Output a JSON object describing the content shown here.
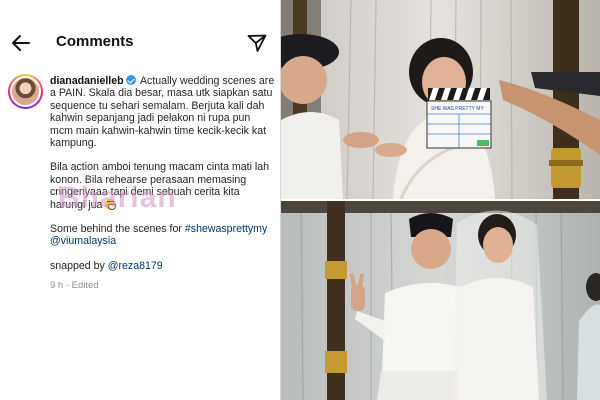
{
  "header": {
    "title": "Comments"
  },
  "comment": {
    "username": "dianadanielleb",
    "paragraphs": [
      "Actually wedding scenes are a PAIN. Skala dia besar, masa utk siapkan satu sequence tu sehari semalam. Berjuta kali dah kahwin sepanjang jadi pelakon ni rupa pun mcm main kahwin-kahwin time kecik-kecik kat kampung.",
      "Bila action amboi tenung macam cinta mati lah konon. Bila rehearse perasaan memasing cringenyaaa tapi demi sebuah cerita kita harungi jua"
    ],
    "behind_text": "Some behind the scenes for",
    "hashtag": "#shewasprettymy",
    "mention": "@viumalaysia",
    "snapped_text": "snapped by",
    "snapped_mention": "@reza8179",
    "time": "9 h",
    "edited": "Edited"
  },
  "watermark": "Bharian",
  "clapperboard": {
    "text": "SHE WAS PRETTY MY"
  },
  "icons": {
    "back": "back-arrow-icon",
    "share": "send-icon",
    "verified": "verified-badge-icon",
    "emoji": "grinning-sweat-emoji-icon"
  },
  "colors": {
    "link": "#00376b",
    "verified": "#3797f0",
    "meta": "#8e8e8e",
    "watermark": "#ce96c4"
  }
}
